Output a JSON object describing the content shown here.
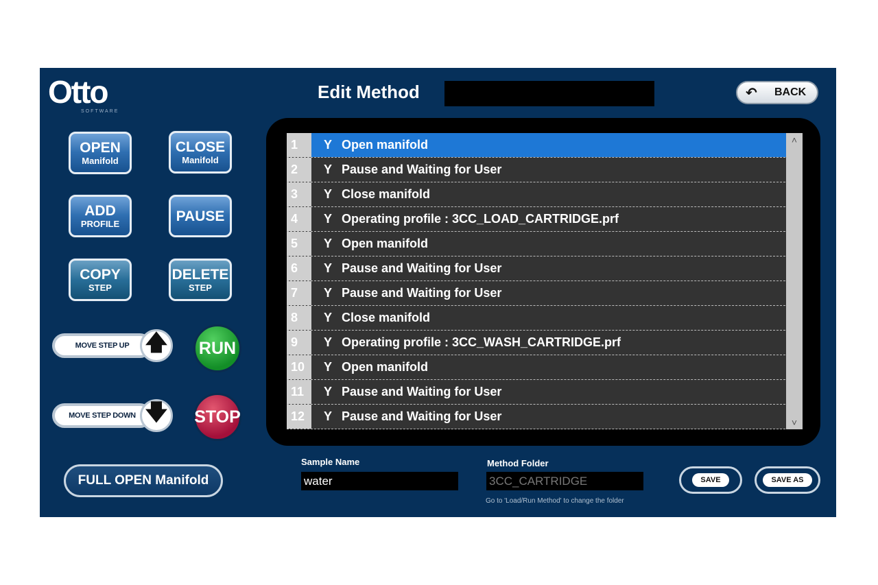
{
  "header": {
    "logo_text": "Otto",
    "logo_subtext": "SOFTWARE",
    "title": "Edit Method",
    "back_label": "BACK"
  },
  "actions": {
    "open_manifold": {
      "big": "OPEN",
      "small": "Manifold"
    },
    "close_manifold": {
      "big": "CLOSE",
      "small": "Manifold"
    },
    "add_profile": {
      "big": "ADD",
      "small": "PROFILE"
    },
    "pause": {
      "big": "PAUSE"
    },
    "copy_step": {
      "big": "COPY",
      "small": "STEP"
    },
    "delete_step": {
      "big": "DELETE",
      "small": "STEP"
    },
    "move_step_up": "MOVE STEP UP",
    "move_step_down": "MOVE STEP DOWN",
    "run": "RUN",
    "stop": "STOP",
    "full_open": "FULL OPEN Manifold"
  },
  "steps": [
    {
      "num": "1",
      "flag": "Y",
      "text": "Open manifold",
      "selected": true
    },
    {
      "num": "2",
      "flag": "Y",
      "text": "Pause and Waiting for User"
    },
    {
      "num": "3",
      "flag": "Y",
      "text": "Close manifold"
    },
    {
      "num": "4",
      "flag": "Y",
      "text": "Operating profile : 3CC_LOAD_CARTRIDGE.prf"
    },
    {
      "num": "5",
      "flag": "Y",
      "text": "Open manifold"
    },
    {
      "num": "6",
      "flag": "Y",
      "text": "Pause and Waiting for User"
    },
    {
      "num": "7",
      "flag": "Y",
      "text": "Pause and Waiting for User"
    },
    {
      "num": "8",
      "flag": "Y",
      "text": "Close manifold"
    },
    {
      "num": "9",
      "flag": "Y",
      "text": "Operating profile : 3CC_WASH_CARTRIDGE.prf"
    },
    {
      "num": "10",
      "flag": "Y",
      "text": "Open manifold"
    },
    {
      "num": "11",
      "flag": "Y",
      "text": "Pause and Waiting for User"
    },
    {
      "num": "12",
      "flag": "Y",
      "text": "Pause and Waiting for User"
    }
  ],
  "form": {
    "sample_name_label": "Sample Name",
    "sample_name_value": "water",
    "method_folder_label": "Method Folder",
    "method_folder_value": "3CC_CARTRIDGE",
    "hint": "Go to 'Load/Run Method' to change the folder",
    "save_label": "SAVE",
    "save_as_label": "SAVE AS"
  },
  "colors": {
    "background": "#06305a",
    "selection": "#1e78d6",
    "run": "#138e27",
    "stop": "#a4103a"
  }
}
